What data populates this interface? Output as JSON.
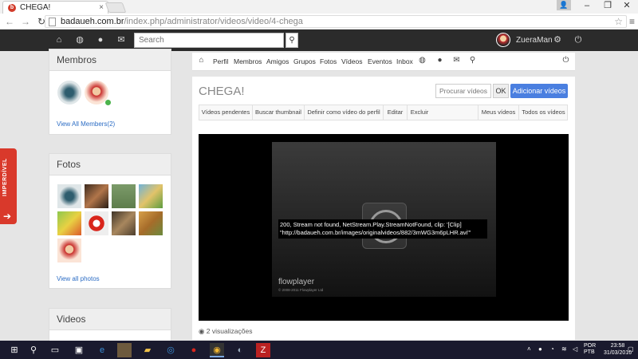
{
  "browser": {
    "tab_title": "CHEGA!",
    "tab_close": "×",
    "url_host": "badaueh.com.br",
    "url_path": "/index.php/administrator/videos/video/4-chega",
    "win_min": "–",
    "win_max": "❐",
    "win_close": "✕"
  },
  "topnav": {
    "search_placeholder": "Search",
    "username": "ZueraMan"
  },
  "sidebar": {
    "members_title": "Membros",
    "members_link": "View All Members(2)",
    "photos_title": "Fotos",
    "photos_link": "View all photos",
    "videos_title": "Videos",
    "side_tab": "IMPERDÍVEL"
  },
  "content_nav": {
    "items": [
      "Perfil",
      "Membros",
      "Amigos",
      "Grupos",
      "Fotos",
      "Vídeos",
      "Eventos",
      "Inbox"
    ]
  },
  "content": {
    "title": "CHEGA!",
    "search_placeholder": "Procurar vídeos",
    "ok_label": "OK",
    "add_label": "Adicionar vídeos",
    "subtabs": [
      "Vídeos pendentes",
      "Buscar thumbnail",
      "Definir como vídeo do perfil",
      "Editar",
      "Excluir",
      "Meus vídeos",
      "Todos os vídeos"
    ],
    "error_message": "200, Stream not found, NetStream.Play.StreamNotFound, clip: '[Clip] \"http://badaueh.com.br/images/originalvideos/882/3mWG3m6pLHR.avi\"'",
    "player_brand": "flowplayer",
    "player_copyright": "© 2008-2011 Flowplayer Ltd",
    "views": "2 visualizações"
  },
  "taskbar": {
    "lang_1": "POR",
    "lang_2": "PTB",
    "time": "23:58",
    "date": "31/03/2016"
  },
  "colors": {
    "accent_blue": "#4a7fe0",
    "side_tab_red": "#d9392b",
    "navbar_dark": "#2b2b2b"
  }
}
